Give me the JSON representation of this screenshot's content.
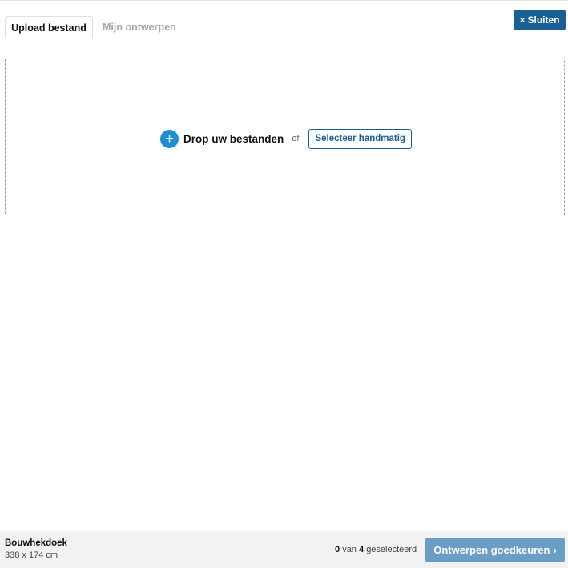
{
  "header": {
    "close_label": "Sluiten",
    "close_icon": "×"
  },
  "tabs": [
    {
      "label": "Upload bestand",
      "active": true
    },
    {
      "label": "Mijn ontwerpen",
      "active": false
    }
  ],
  "dropzone": {
    "plus_icon": "+",
    "drop_label": "Drop uw bestanden",
    "or_label": "of",
    "select_label": "Selecteer handmatig"
  },
  "footer": {
    "product_name": "Bouwhekdoek",
    "product_size": "338 x 174 cm",
    "selected_count": "0",
    "selected_of": "van",
    "total_count": "4",
    "selected_suffix": "geselecteerd",
    "approve_label": "Ontwerpen goedkeuren",
    "approve_icon": "›"
  },
  "colors": {
    "primary": "#1a5f93",
    "accent": "#1b8fd0",
    "approve_disabled": "#6a9ec6",
    "footer_bg": "#f2f2f2"
  }
}
